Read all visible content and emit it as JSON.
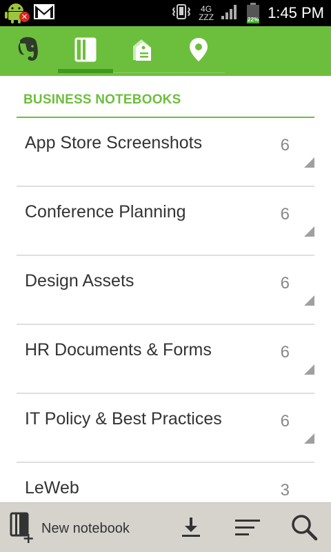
{
  "status_bar": {
    "network_type": "4G",
    "sleep_indicator": "ZZZ",
    "battery_percent": "22%",
    "time": "1:45 PM",
    "icons": [
      "android-icon",
      "notification-error-icon",
      "gmail-icon",
      "vibrate-icon",
      "signal-icon",
      "battery-icon"
    ]
  },
  "toolbar": {
    "tabs": [
      {
        "name": "evernote-logo-icon",
        "active": false
      },
      {
        "name": "notebooks-icon",
        "active": true
      },
      {
        "name": "tags-icon",
        "active": false
      },
      {
        "name": "places-icon",
        "active": false
      }
    ],
    "accent_color": "#6cbf3c"
  },
  "section": {
    "title": "BUSINESS NOTEBOOKS"
  },
  "notebooks": [
    {
      "name": "App Store Screenshots",
      "count": "6"
    },
    {
      "name": "Conference Planning",
      "count": "6"
    },
    {
      "name": "Design Assets",
      "count": "6"
    },
    {
      "name": "HR Documents & Forms",
      "count": "6"
    },
    {
      "name": "IT Policy & Best Practices",
      "count": "6"
    },
    {
      "name": "LeWeb",
      "count": "3"
    }
  ],
  "bottom_bar": {
    "new_notebook_label": "New notebook",
    "icons": [
      "new-notebook-icon",
      "download-icon",
      "sort-icon",
      "search-icon"
    ]
  }
}
